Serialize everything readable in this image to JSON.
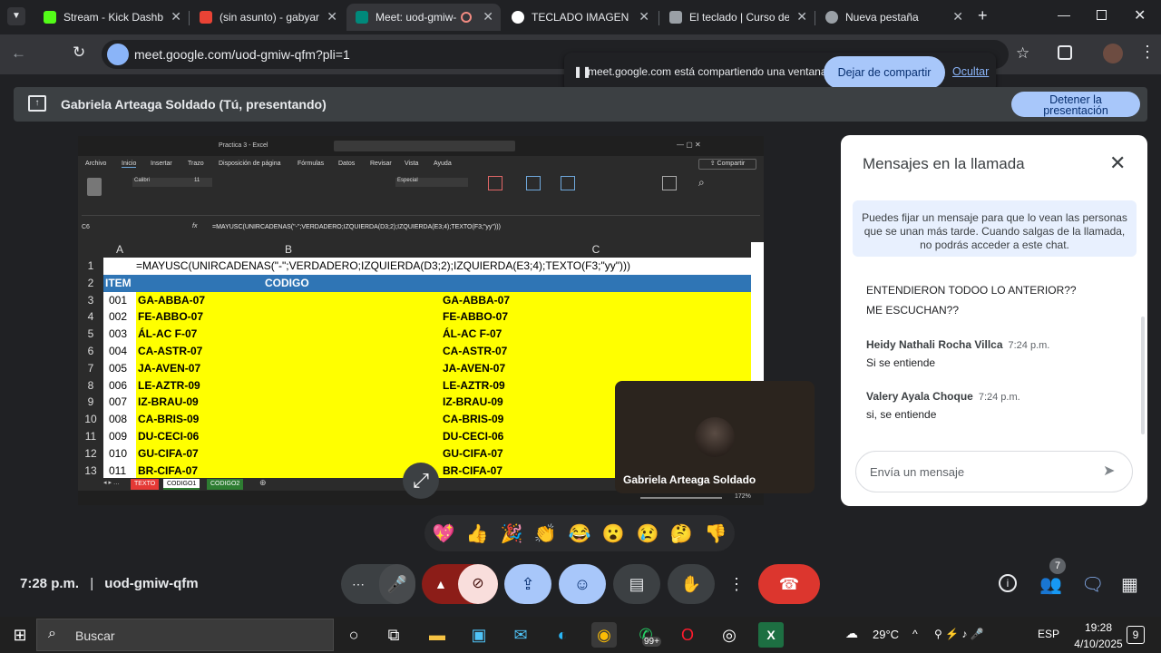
{
  "browser": {
    "tabs": [
      {
        "label": "Stream - Kick Dashbo",
        "icon": "kick-icon",
        "color": "#53fc18"
      },
      {
        "label": "(sin asunto) - gabyart",
        "icon": "gmail-icon",
        "color": "#ea4335"
      },
      {
        "label": "Meet: uod-gmiw-",
        "icon": "meet-icon",
        "color": "#00897b",
        "active": true
      },
      {
        "label": "TECLADO IMAGEN - ",
        "icon": "google-icon",
        "color": "#4285f4"
      },
      {
        "label": "El teclado | Curso de",
        "icon": "site-icon",
        "color": "#9aa0a6"
      },
      {
        "label": "Nueva pestaña",
        "icon": "chrome-icon",
        "color": "#9aa0a6"
      }
    ],
    "url": "meet.google.com/uod-gmiw-qfm?pli=1"
  },
  "share_banner": {
    "text": "meet.google.com está compartiendo una ventana.",
    "stop_label": "Dejar de compartir",
    "hide_label": "Ocultar"
  },
  "presenting": {
    "title": "Gabriela Arteaga Soldado (Tú, presentando)",
    "stop_label_1": "Detener la",
    "stop_label_2": "presentación"
  },
  "excel": {
    "title": "Practica 3 - Excel",
    "menu": [
      "Archivo",
      "Inicio",
      "Insertar",
      "Trazo",
      "Disposición de página",
      "Fórmulas",
      "Datos",
      "Revisar",
      "Vista",
      "Ayuda"
    ],
    "share": "Compartir",
    "cell_ref": "C6",
    "formula": "=MAYUSC(UNIRCADENAS(\"-\";VERDADERO;IZQUIERDA(D3;2);IZQUIERDA(E3;4);TEXTO(F3;\"yy\")))",
    "columns": [
      "A",
      "B",
      "C"
    ],
    "row1_formula": "=MAYUSC(UNIRCADENAS(\"-\";VERDADERO;IZQUIERDA(D3;2);IZQUIERDA(E3;4);TEXTO(F3;\"yy\")))",
    "header": {
      "item": "ITEM",
      "codigo": "CODIGO"
    },
    "rows": [
      {
        "n": "3",
        "item": "001",
        "b": "GA-ABBA-07",
        "c": "GA-ABBA-07"
      },
      {
        "n": "4",
        "item": "002",
        "b": "FE-ABBO-07",
        "c": "FE-ABBO-07"
      },
      {
        "n": "5",
        "item": "003",
        "b": "ÁL-AC F-07",
        "c": "ÁL-AC F-07"
      },
      {
        "n": "6",
        "item": "004",
        "b": "CA-ASTR-07",
        "c": "CA-ASTR-07"
      },
      {
        "n": "7",
        "item": "005",
        "b": "JA-AVEN-07",
        "c": "JA-AVEN-07"
      },
      {
        "n": "8",
        "item": "006",
        "b": "LE-AZTR-09",
        "c": "LE-AZTR-09"
      },
      {
        "n": "9",
        "item": "007",
        "b": "IZ-BRAU-09",
        "c": "IZ-BRAU-09"
      },
      {
        "n": "10",
        "item": "008",
        "b": "CA-BRIS-09",
        "c": "CA-BRIS-09"
      },
      {
        "n": "11",
        "item": "009",
        "b": "DU-CECI-06",
        "c": "DU-CECI-06"
      },
      {
        "n": "12",
        "item": "010",
        "b": "GU-CIFA-07",
        "c": "GU-CIFA-07"
      },
      {
        "n": "13",
        "item": "011",
        "b": "BR-CIFA-07",
        "c": "BR-CIFA-07"
      }
    ],
    "sheets": [
      "TEXTO",
      "CODIGO1",
      "CODIGO2"
    ],
    "zoom": "172%"
  },
  "self_tile": {
    "name": "Gabriela Arteaga Soldado"
  },
  "chat": {
    "title": "Mensajes en la llamada",
    "note": "Puedes fijar un mensaje para que lo vean las personas que se unan más tarde. Cuando salgas de la llamada, no podrás acceder a este chat.",
    "messages_top": [
      "ENTENDIERON TODOO LO ANTERIOR??",
      "ME ESCUCHAN??"
    ],
    "messages": [
      {
        "sender": "Heidy Nathali Rocha Villca",
        "time": "7:24 p.m.",
        "text": "Si se entiende"
      },
      {
        "sender": "Valery Ayala Choque",
        "time": "7:24 p.m.",
        "text": "si, se entiende"
      }
    ],
    "placeholder": "Envía un mensaje"
  },
  "reactions": [
    "💖",
    "👍",
    "🎉",
    "👏",
    "😂",
    "😮",
    "😢",
    "🤔",
    "👎"
  ],
  "meeting": {
    "time": "7:28 p.m.",
    "code": "uod-gmiw-qfm",
    "participants": "7"
  },
  "taskbar": {
    "search_placeholder": "Buscar",
    "temperature": "29°C",
    "lang": "ESP",
    "clock_time": "19:28",
    "clock_date": "4/10/2025",
    "notif": "9",
    "badge": "99+"
  }
}
